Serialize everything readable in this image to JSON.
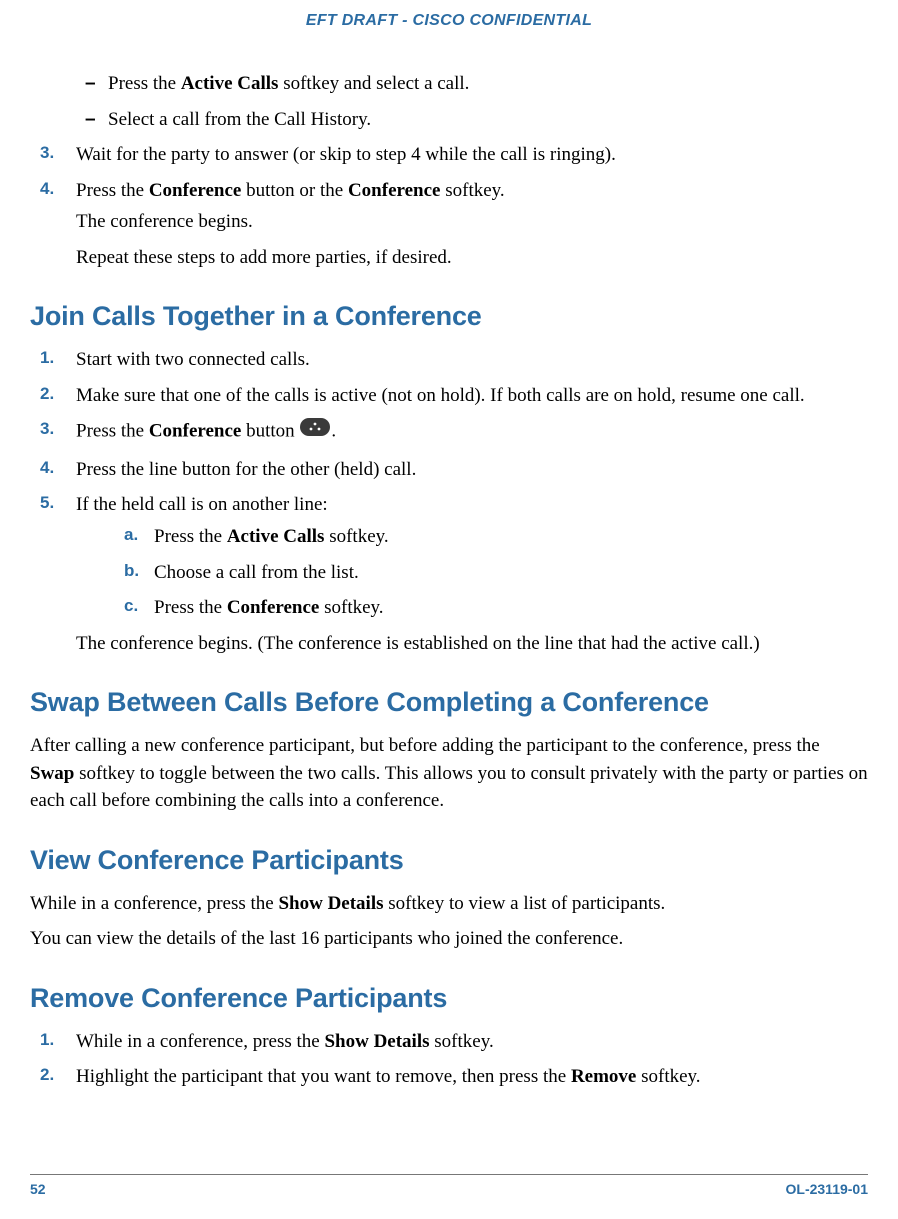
{
  "header": "EFT DRAFT - CISCO CONFIDENTIAL",
  "footer": {
    "page": "52",
    "doc": "OL-23119-01"
  },
  "intro_bullets": [
    {
      "pre": "Press the ",
      "b": "Active Calls",
      "post": " softkey and select a call."
    },
    {
      "pre": "Select a call from the Call History.",
      "b": "",
      "post": ""
    }
  ],
  "step3": {
    "num": "3.",
    "text": "Wait for the party to answer (or skip to step 4 while the call is ringing)."
  },
  "step4": {
    "num": "4.",
    "p1a": "Press the ",
    "p1b": "Conference",
    "p1c": " button or the ",
    "p1d": "Conference",
    "p1e": " softkey.",
    "p2": "The conference begins.",
    "p3": "Repeat these steps to add more parties, if desired."
  },
  "join": {
    "title": "Join Calls Together in a Conference",
    "s1": {
      "num": "1.",
      "text": "Start with two connected calls."
    },
    "s2": {
      "num": "2.",
      "text": "Make sure that one of the calls is active (not on hold). If both calls are on hold, resume one call."
    },
    "s3": {
      "num": "3.",
      "a": "Press the ",
      "b": "Conference",
      "c": " button ",
      "d": "."
    },
    "s4": {
      "num": "4.",
      "text": "Press the line button for the other (held) call."
    },
    "s5": {
      "num": "5.",
      "text": "If the held call is on another line:",
      "a": {
        "num": "a.",
        "pre": "Press the ",
        "b": "Active Calls",
        "post": " softkey."
      },
      "b": {
        "num": "b.",
        "text": "Choose a call from the list."
      },
      "c": {
        "num": "c.",
        "pre": "Press the ",
        "b": "Conference",
        "post": " softkey."
      },
      "after": "The conference begins. (The conference is established on the line that had the active call.)"
    }
  },
  "swap": {
    "title": "Swap Between Calls Before Completing a Conference",
    "p_a": "After calling a new conference participant, but before adding the participant to the conference, press the ",
    "p_b": "Swap",
    "p_c": " softkey to toggle between the two calls. This allows you to consult privately with the party or parties on each call before combining the calls into a conference."
  },
  "view": {
    "title": "View Conference Participants",
    "p1a": "While in a conference, press the ",
    "p1b": "Show Details",
    "p1c": " softkey to view a list of participants.",
    "p2": "You can view the details of the last 16 participants who joined the conference."
  },
  "remove": {
    "title": "Remove Conference Participants",
    "s1": {
      "num": "1.",
      "a": "While in a conference, press the ",
      "b": "Show Details",
      "c": " softkey."
    },
    "s2": {
      "num": "2.",
      "a": "Highlight the participant that you want to remove, then press the ",
      "b": "Remove",
      "c": " softkey."
    }
  }
}
